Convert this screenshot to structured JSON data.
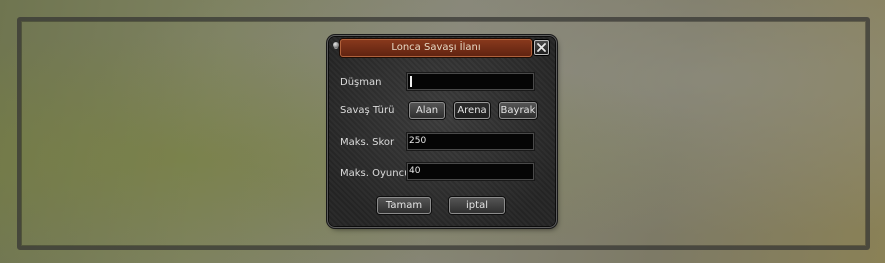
{
  "dialog": {
    "title": "Lonca Savaşı İlanı",
    "enemy": {
      "label": "Düşman",
      "value": ""
    },
    "war_type": {
      "label": "Savaş Türü",
      "options": [
        "Alan",
        "Arena",
        "Bayrak"
      ],
      "selected": "Arena"
    },
    "max_score": {
      "label": "Maks. Skor",
      "value": "250"
    },
    "max_players": {
      "label": "Maks. Oyuncu",
      "value": "40"
    },
    "ok_label": "Tamam",
    "cancel_label": "iptal"
  }
}
